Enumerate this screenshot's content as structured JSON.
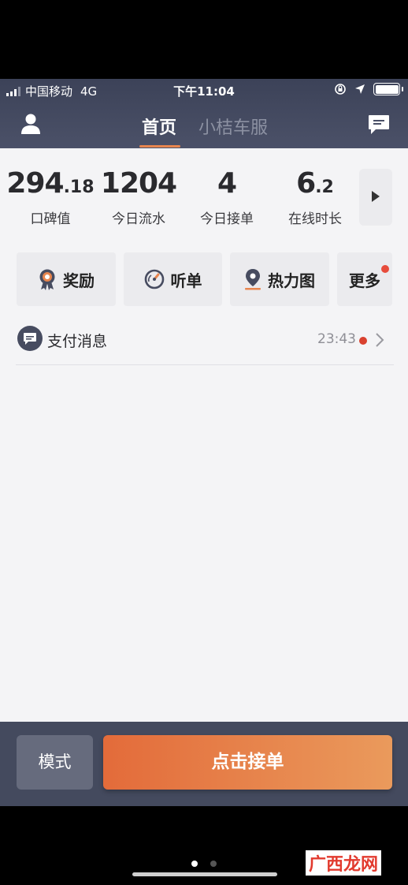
{
  "status_bar": {
    "carrier": "中国移动",
    "network": "4G",
    "time": "下午11:04",
    "battery_level": 1.0
  },
  "nav": {
    "tabs": [
      {
        "label": "首页",
        "active": true
      },
      {
        "label": "小桔车服",
        "active": false
      }
    ]
  },
  "stats": [
    {
      "value": "294",
      "decimal": ".18",
      "label": "口碑值"
    },
    {
      "value": "1204",
      "decimal": "",
      "label": "今日流水"
    },
    {
      "value": "4",
      "decimal": "",
      "label": "今日接单"
    },
    {
      "value": "6",
      "decimal": ".2",
      "label": "在线时长"
    }
  ],
  "quick_actions": [
    {
      "label": "奖励",
      "icon": "medal-icon"
    },
    {
      "label": "听单",
      "icon": "gauge-icon"
    },
    {
      "label": "热力图",
      "icon": "map-pin-icon"
    },
    {
      "label": "更多",
      "badge": true
    }
  ],
  "message": {
    "title": "支付消息",
    "time": "23:43",
    "unread": true
  },
  "bottom": {
    "mode_label": "模式",
    "accept_label": "点击接单"
  },
  "page_indicator": {
    "count": 2,
    "active": 0
  },
  "watermark": "广西龙网",
  "colors": {
    "header_bg": "#444a5e",
    "accent": "#e8864f",
    "accept_gradient_start": "#e36b3a",
    "accept_gradient_end": "#ea9a5c",
    "badge_red": "#e74c3c"
  }
}
